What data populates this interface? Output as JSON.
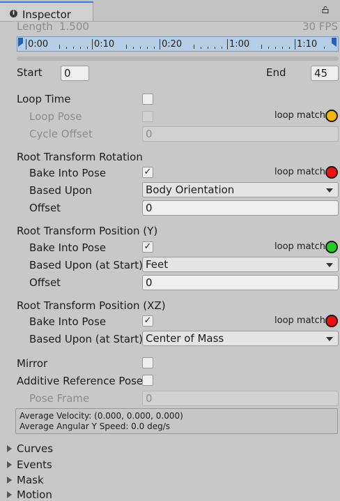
{
  "tab": {
    "title": "Inspector"
  },
  "clip": {
    "length_label": "Length",
    "length_value": "1.500",
    "fps": "30 FPS"
  },
  "timeline": {
    "ticks": [
      "0:00",
      "0:10",
      "0:20",
      "1:00",
      "1:10"
    ]
  },
  "range": {
    "start_label": "Start",
    "start_value": "0",
    "end_label": "End",
    "end_value": "45"
  },
  "loop": {
    "loop_time": "Loop Time",
    "loop_pose": "Loop Pose",
    "cycle_offset": "Cycle Offset",
    "cycle_offset_value": "0",
    "loop_match": "loop match"
  },
  "rotation": {
    "header": "Root Transform Rotation",
    "bake": "Bake Into Pose",
    "based": "Based Upon",
    "based_value": "Body Orientation",
    "offset": "Offset",
    "offset_value": "0",
    "loop_match": "loop match"
  },
  "position_y": {
    "header": "Root Transform Position (Y)",
    "bake": "Bake Into Pose",
    "based": "Based Upon (at Start)",
    "based_value": "Feet",
    "offset": "Offset",
    "offset_value": "0",
    "loop_match": "loop match"
  },
  "position_xz": {
    "header": "Root Transform Position (XZ)",
    "bake": "Bake Into Pose",
    "based": "Based Upon (at Start)",
    "based_value": "Center of Mass",
    "loop_match": "loop match"
  },
  "misc": {
    "mirror": "Mirror",
    "additive": "Additive Reference Pose",
    "pose_frame": "Pose Frame",
    "pose_frame_value": "0"
  },
  "info": {
    "velocity": "Average Velocity: (0.000, 0.000, 0.000)",
    "angular": "Average Angular Y Speed: 0.0 deg/s"
  },
  "foldouts": [
    "Curves",
    "Events",
    "Mask",
    "Motion"
  ],
  "colors": {
    "yellow": "#f5b400",
    "red": "#ee1111",
    "green": "#22cc22",
    "accent": "#3a7cdd"
  }
}
